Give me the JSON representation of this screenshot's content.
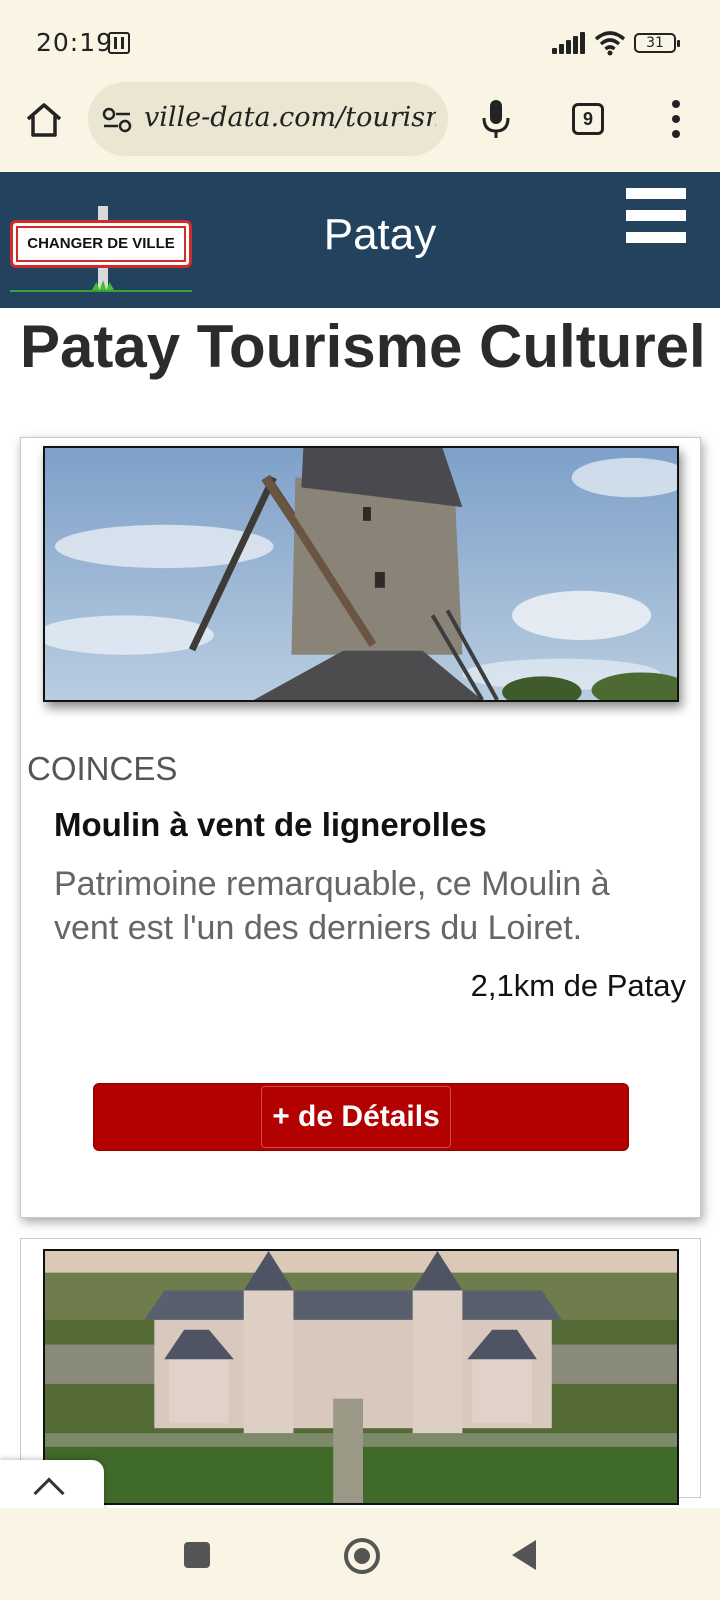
{
  "status_bar": {
    "time": "20:19",
    "battery": "31",
    "icons": [
      "nfc-icon",
      "signal-icon",
      "wifi-icon",
      "battery-icon"
    ]
  },
  "browser": {
    "url": "ville-data.com/tourism",
    "tab_count": "9",
    "icons": [
      "home-icon",
      "site-settings-icon",
      "mic-icon",
      "tabs-icon",
      "menu-dots-icon"
    ]
  },
  "header": {
    "change_city_label": "CHANGER DE VILLE",
    "city": "Patay",
    "menu_icon": "hamburger-icon",
    "colors": {
      "background": "#23425d",
      "sign_border": "#d12a2a"
    }
  },
  "page": {
    "title": "Patay Tourisme Culturel"
  },
  "cards": [
    {
      "location": "COINCES",
      "name": "Moulin à vent de lignerolles",
      "description": "Patrimoine remarquable, ce Moulin à vent est l'un des derniers du Loiret.",
      "distance": "2,1km de Patay",
      "button_label": "+ de Détails",
      "image": "windmill-photo"
    },
    {
      "image": "chateau-photo"
    }
  ],
  "colors": {
    "button": "#b30000",
    "chrome": "#f9f4e3"
  },
  "nav": {
    "icons": [
      "recents-square-icon",
      "home-circle-icon",
      "back-triangle-icon",
      "chevron-up-icon"
    ]
  }
}
